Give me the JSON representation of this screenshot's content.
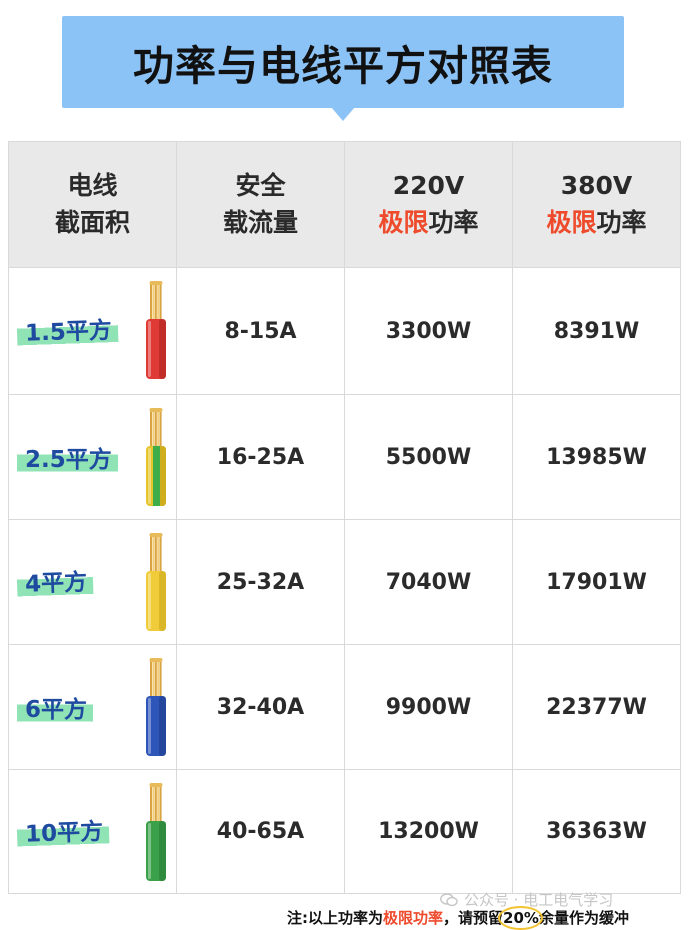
{
  "title": "功率与电线平方对照表",
  "header": {
    "col1_line1": "电线",
    "col1_line2": "截面积",
    "col2_line1": "安全",
    "col2_line2": "载流量",
    "col3_line1": "220V",
    "col3_hl": "极限",
    "col3_rest": "功率",
    "col4_line1": "380V",
    "col4_hl": "极限",
    "col4_rest": "功率"
  },
  "rows": [
    {
      "size": "1.5平方",
      "current": "8-15A",
      "p220": "3300W",
      "p380": "8391W",
      "wire_color": "#e03a36",
      "wire_shade": "#a8221f",
      "stripe_color": ""
    },
    {
      "size": "2.5平方",
      "current": "16-25A",
      "p220": "5500W",
      "p380": "13985W",
      "wire_color": "#e6c52a",
      "wire_shade": "#b99a12",
      "stripe_color": "#3fae4a"
    },
    {
      "size": "4平方",
      "current": "25-32A",
      "p220": "7040W",
      "p380": "17901W",
      "wire_color": "#f0cc3a",
      "wire_shade": "#c9a51c",
      "stripe_color": ""
    },
    {
      "size": "6平方",
      "current": "32-40A",
      "p220": "9900W",
      "p380": "22377W",
      "wire_color": "#2e55b8",
      "wire_shade": "#1d3a86",
      "stripe_color": ""
    },
    {
      "size": "10平方",
      "current": "40-65A",
      "p220": "13200W",
      "p380": "36363W",
      "wire_color": "#3aa14a",
      "wire_shade": "#267a33",
      "stripe_color": ""
    }
  ],
  "footer": {
    "watermark": "公众号 · 电工电气学习",
    "note_prefix": "注:以上功率为",
    "note_hl": "极限功率",
    "note_mid": "，请预留",
    "note_pct": "20%",
    "note_suffix": "余量作为缓冲"
  },
  "colors": {
    "title_bg": "#8cc3f6",
    "highlight": "#ee4a2c",
    "size_text": "#1e4aa0",
    "size_marker": "#8fe3b4",
    "header_bg": "#e9e9e9",
    "copper": "#d9a441"
  }
}
